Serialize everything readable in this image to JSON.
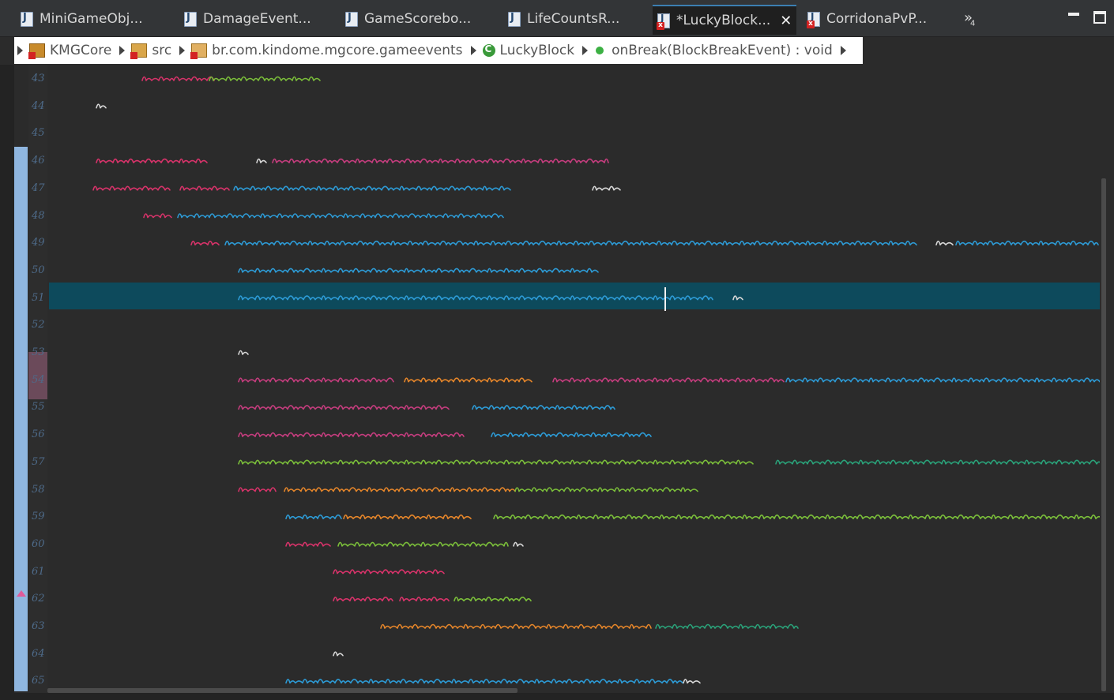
{
  "tabs": [
    {
      "label": "MiniGameObj...",
      "icon": "java-file-icon"
    },
    {
      "label": "DamageEvent...",
      "icon": "java-file-icon"
    },
    {
      "label": "GameScorebo...",
      "icon": "java-file-icon"
    },
    {
      "label": "LifeCountsR...",
      "icon": "java-file-icon"
    },
    {
      "label": "*LuckyBlock...",
      "icon": "java-file-error-icon",
      "active": true
    },
    {
      "label": "CorridonaPvP...",
      "icon": "java-file-error-icon"
    }
  ],
  "tab_close_glyph": "✕",
  "overflow_glyph": "»",
  "overflow_count": "4",
  "breadcrumb": [
    {
      "label": "KMGCore",
      "icon": "project-icon"
    },
    {
      "label": "src",
      "icon": "source-folder-icon"
    },
    {
      "label": "br.com.kindome.mgcore.gameevents",
      "icon": "package-icon"
    },
    {
      "label": "LuckyBlock",
      "icon": "class-icon"
    },
    {
      "label": "onBreak(BlockBreakEvent) : void",
      "icon": "public-method-icon"
    }
  ],
  "line_numbers": [
    "43",
    "44",
    "45",
    "46",
    "47",
    "48",
    "49",
    "50",
    "51",
    "52",
    "53",
    "54",
    "55",
    "56",
    "57",
    "58",
    "59",
    "60",
    "61",
    "62",
    "63",
    "64",
    "65"
  ],
  "colors": {
    "accent": "#3c7fb1",
    "current_line": "#0d4a5c",
    "change_bar": "#8fb6df",
    "keyword": "#d8336a",
    "type": "#c53d7e",
    "method": "#2d9bd6",
    "variable": "#7bbf3a",
    "string": "#e6862a",
    "comment": "#2aa37a",
    "plain": "#d8d8d8"
  }
}
